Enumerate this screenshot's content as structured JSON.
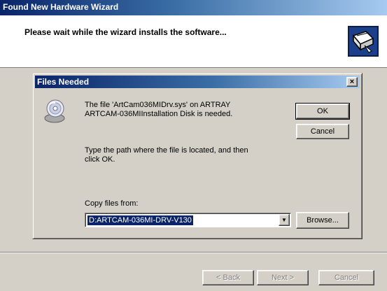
{
  "wizard": {
    "title": "Found New Hardware Wizard",
    "heading": "Please wait while the wizard installs the software...",
    "icon": "hardware-install-icon",
    "buttons": {
      "back": "< Back",
      "next": "Next >",
      "cancel": "Cancel"
    }
  },
  "dialog": {
    "title": "Files Needed",
    "close": "×",
    "message": "The file 'ArtCam036MIDrv.sys' on ARTRAY ARTCAM-036MIInstallation Disk is needed.",
    "path_hint": "Type the path where the file is located, and then click OK.",
    "copy_label": "Copy files from:",
    "copy_value": "D:ARTCAM-036MI-DRV-V130",
    "dropdown_glyph": "▼",
    "buttons": {
      "ok": "OK",
      "cancel": "Cancel",
      "browse": "Browse..."
    },
    "icon": "cd-disk-icon"
  },
  "colors": {
    "face": "#d4d0c8",
    "title_active": "#0a246a",
    "title_gradient_end": "#a6caf0",
    "selection": "#0a246a"
  }
}
